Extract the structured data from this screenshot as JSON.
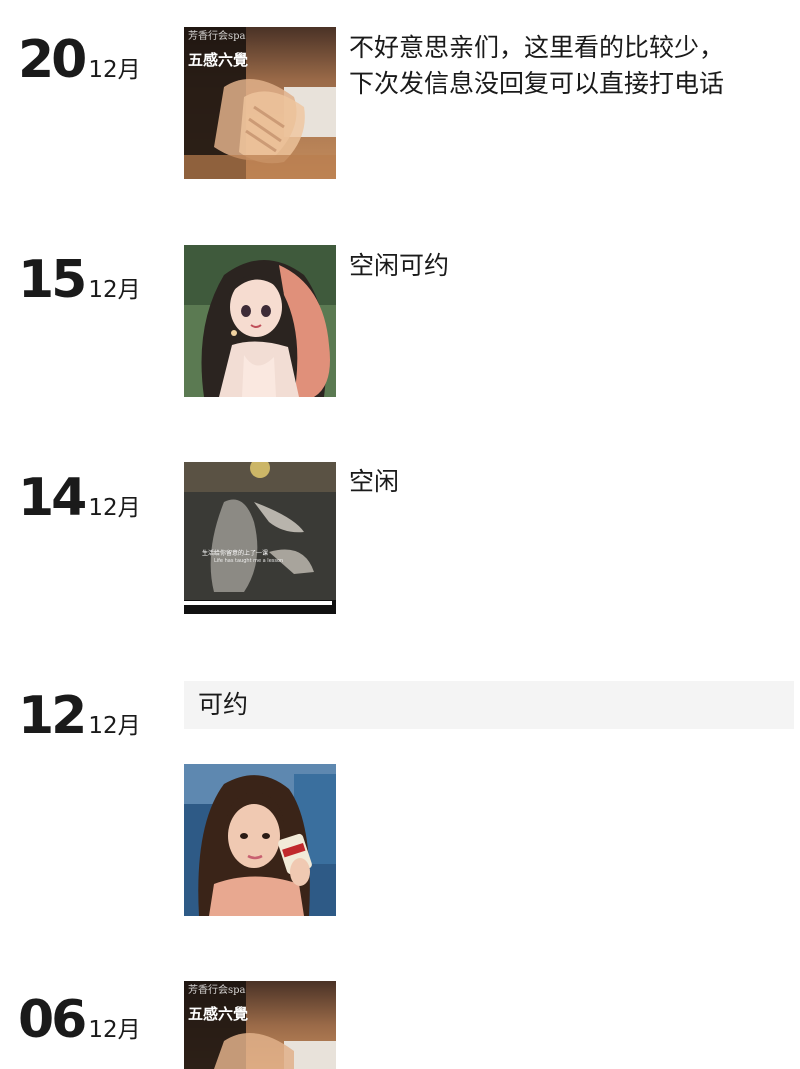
{
  "posts": [
    {
      "day": "20",
      "month": "12月",
      "image": {
        "kind": "spa-massage",
        "overlay_top": "芳香行会spa",
        "overlay_title": "五感六覺"
      },
      "caption_lines": [
        "不好意思亲们，这里看的比较少，",
        "下次发信息没回复可以直接打电话"
      ]
    },
    {
      "day": "15",
      "month": "12月",
      "image": {
        "kind": "anime-girl-illustration"
      },
      "caption_lines": [
        "空闲可约"
      ]
    },
    {
      "day": "14",
      "month": "12月",
      "image": {
        "kind": "video-still-dancer",
        "subtitle_cn": "生活给你留意的上了一课",
        "subtitle_en": "Life has taught me a lesson"
      },
      "caption_lines": [
        "空闲"
      ]
    },
    {
      "day": "12",
      "month": "12月",
      "text_card": "可约",
      "image": {
        "kind": "selfie-woman-with-cup"
      }
    },
    {
      "day": "06",
      "month": "12月",
      "image": {
        "kind": "spa-massage",
        "overlay_top": "芳香行会spa",
        "overlay_title": "五感六覺"
      }
    }
  ],
  "colors": {
    "text": "#1a1a1a",
    "card_bg": "#f4f4f4",
    "page_bg": "#ffffff"
  }
}
